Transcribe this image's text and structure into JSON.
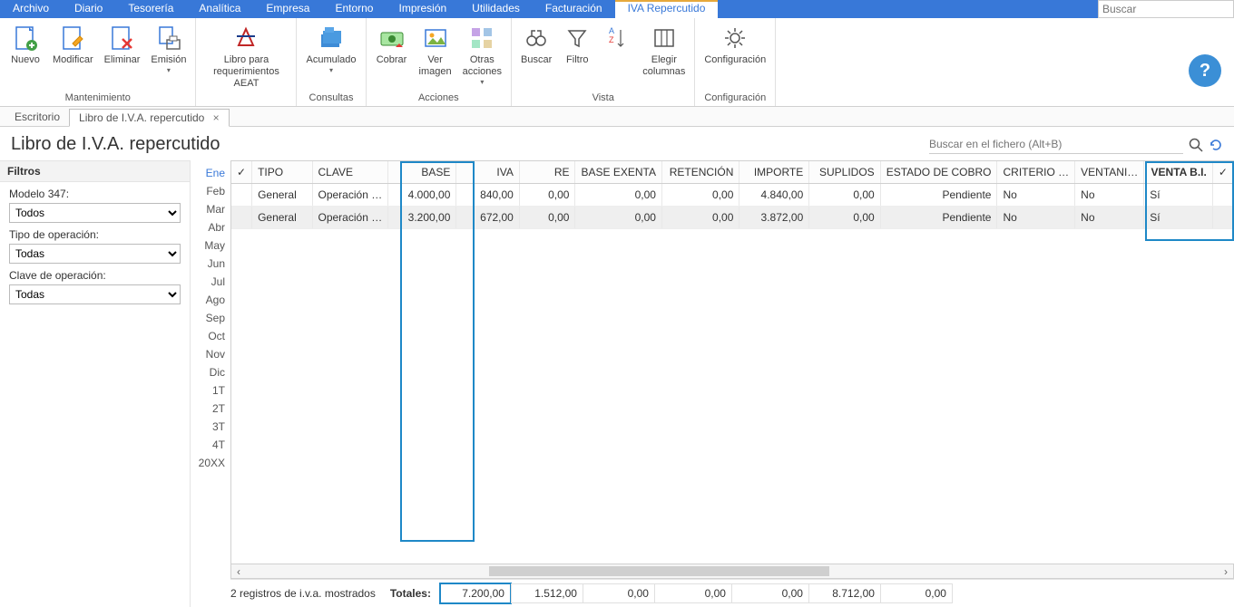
{
  "menu": {
    "archivo": "Archivo",
    "diario": "Diario",
    "tesoreria": "Tesorería",
    "analitica": "Analítica",
    "empresa": "Empresa",
    "entorno": "Entorno",
    "impresion": "Impresión",
    "utilidades": "Utilidades",
    "facturacion": "Facturación",
    "iva": "IVA Repercutido"
  },
  "search_placeholder": "Buscar",
  "ribbon": {
    "mantenimiento": {
      "label": "Mantenimiento",
      "nuevo": "Nuevo",
      "modificar": "Modificar",
      "eliminar": "Eliminar",
      "emision": "Emisión"
    },
    "aeat": {
      "libro": "Libro para\nrequerimientos AEAT"
    },
    "consultas": {
      "label": "Consultas",
      "acumulado": "Acumulado"
    },
    "acciones": {
      "label": "Acciones",
      "cobrar": "Cobrar",
      "ver_imagen": "Ver\nimagen",
      "otras": "Otras\nacciones"
    },
    "vista": {
      "label": "Vista",
      "buscar": "Buscar",
      "filtro": "Filtro",
      "elegir": "Elegir\ncolumnas"
    },
    "config": {
      "label": "Configuración",
      "config": "Configuración"
    }
  },
  "tabs": {
    "escritorio": "Escritorio",
    "libro": "Libro de I.V.A. repercutido"
  },
  "page_title": "Libro de I.V.A. repercutido",
  "page_search_placeholder": "Buscar en el fichero (Alt+B)",
  "filters": {
    "section": "Filtros",
    "modelo": {
      "label": "Modelo 347:",
      "value": "Todos"
    },
    "tipo": {
      "label": "Tipo de operación:",
      "value": "Todas"
    },
    "clave": {
      "label": "Clave de operación:",
      "value": "Todas"
    }
  },
  "months": [
    "Ene",
    "Feb",
    "Mar",
    "Abr",
    "May",
    "Jun",
    "Jul",
    "Ago",
    "Sep",
    "Oct",
    "Nov",
    "Dic",
    "1T",
    "2T",
    "3T",
    "4T",
    "20XX"
  ],
  "active_month": 0,
  "columns": {
    "tipo": "TIPO",
    "clave": "CLAVE",
    "base": "BASE",
    "iva": "IVA",
    "re": "RE",
    "base_exenta": "BASE EXENTA",
    "retencion": "RETENCIÓN",
    "importe": "IMPORTE",
    "suplidos": "SUPLIDOS",
    "estado": "ESTADO DE COBRO",
    "criterio": "CRITERIO …",
    "ventani": "VENTANI…",
    "venta_bi": "VENTA B.I."
  },
  "rows": [
    {
      "tipo": "General",
      "clave": "Operación …",
      "base": "4.000,00",
      "iva": "840,00",
      "re": "0,00",
      "base_exenta": "0,00",
      "retencion": "0,00",
      "importe": "4.840,00",
      "suplidos": "0,00",
      "estado": "Pendiente",
      "criterio": "No",
      "ventani": "No",
      "venta_bi": "Sí"
    },
    {
      "tipo": "General",
      "clave": "Operación …",
      "base": "3.200,00",
      "iva": "672,00",
      "re": "0,00",
      "base_exenta": "0,00",
      "retencion": "0,00",
      "importe": "3.872,00",
      "suplidos": "0,00",
      "estado": "Pendiente",
      "criterio": "No",
      "ventani": "No",
      "venta_bi": "Sí"
    }
  ],
  "footer": {
    "count": "2 registros de i.v.a. mostrados",
    "totales": "Totales:",
    "base": "7.200,00",
    "iva": "1.512,00",
    "re": "0,00",
    "base_exenta": "0,00",
    "retencion": "0,00",
    "importe": "8.712,00",
    "suplidos": "0,00"
  }
}
